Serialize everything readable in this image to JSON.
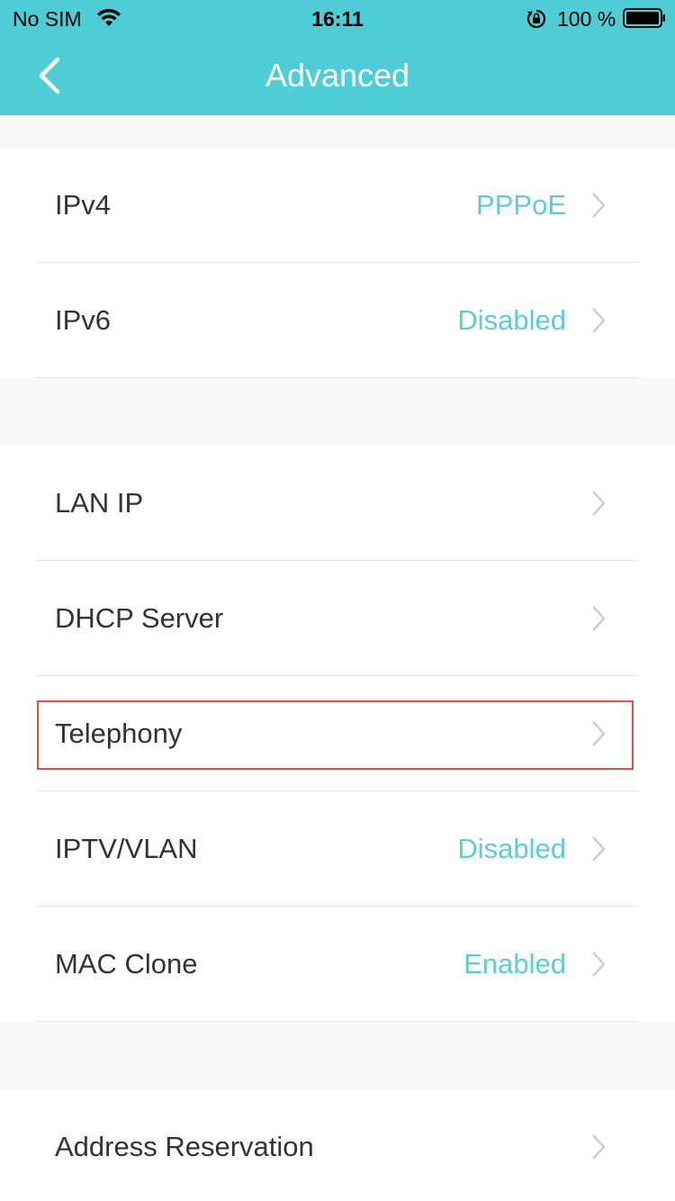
{
  "status_bar": {
    "carrier": "No SIM",
    "time": "16:11",
    "battery_percent": "100 %"
  },
  "nav": {
    "title": "Advanced",
    "back_icon": "chevron-left-icon"
  },
  "colors": {
    "nav_background": "#4ecdd6",
    "value_text": "#5ccdd6",
    "highlight_border": "#d9534f"
  },
  "groups": [
    {
      "items": [
        {
          "label": "IPv4",
          "value": "PPPoE"
        },
        {
          "label": "IPv6",
          "value": "Disabled"
        }
      ]
    },
    {
      "items": [
        {
          "label": "LAN IP",
          "value": ""
        },
        {
          "label": "DHCP Server",
          "value": ""
        },
        {
          "label": "Telephony",
          "value": ""
        },
        {
          "label": "IPTV/VLAN",
          "value": "Disabled"
        },
        {
          "label": "MAC Clone",
          "value": "Enabled"
        }
      ]
    },
    {
      "items": [
        {
          "label": "Address Reservation",
          "value": ""
        }
      ]
    }
  ]
}
